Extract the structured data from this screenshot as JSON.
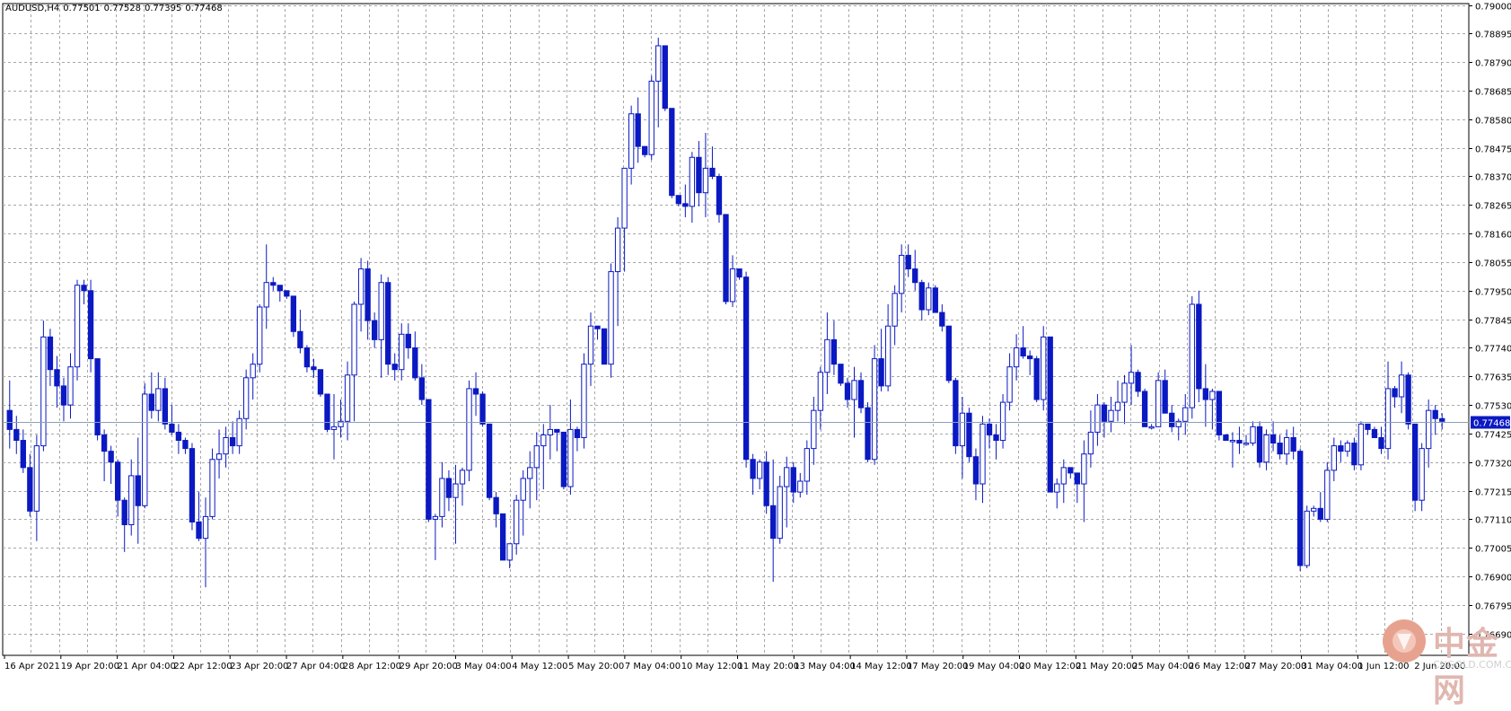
{
  "header": {
    "symbol": "AUDUSD,H4",
    "open": "0.77501",
    "high": "0.77528",
    "low": "0.77395",
    "close": "0.77468"
  },
  "price_tag": "0.77468",
  "logo": {
    "cn": "中金网",
    "en": "CNGOLD.COM.CN"
  },
  "colors": {
    "candle": "#0b19c2",
    "grid": "#a7a7a7",
    "axis_text": "#000000",
    "price_line": "#8aa0b8",
    "tag_bg": "#0b19c2",
    "tag_text": "#ffffff"
  },
  "chart_data": {
    "type": "candlestick",
    "ylim": [
      0.7661,
      0.79005
    ],
    "y_ticks": [
      "0.79000",
      "0.78895",
      "0.78790",
      "0.78685",
      "0.78580",
      "0.78475",
      "0.78370",
      "0.78265",
      "0.78160",
      "0.78055",
      "0.77950",
      "0.77845",
      "0.77740",
      "0.77635",
      "0.77530",
      "0.77425",
      "0.77320",
      "0.77215",
      "0.77110",
      "0.77005",
      "0.76900",
      "0.76795",
      "0.76690"
    ],
    "x_ticks": [
      "16 Apr 2021",
      "19 Apr 20:00",
      "21 Apr 04:00",
      "22 Apr 12:00",
      "23 Apr 20:00",
      "27 Apr 04:00",
      "28 Apr 12:00",
      "29 Apr 20:00",
      "3 May 04:00",
      "4 May 12:00",
      "5 May 20:00",
      "7 May 04:00",
      "10 May 12:00",
      "11 May 20:00",
      "13 May 04:00",
      "14 May 12:00",
      "17 May 20:00",
      "19 May 04:00",
      "20 May 12:00",
      "21 May 20:00",
      "25 May 04:00",
      "26 May 12:00",
      "27 May 20:00",
      "31 May 04:00",
      "1 Jun 12:00",
      "2 Jun 20:00"
    ],
    "last_price": 0.77468,
    "candles": [
      [
        0.7751,
        0.7762,
        0.7737,
        0.7744
      ],
      [
        0.7744,
        0.7749,
        0.7735,
        0.774
      ],
      [
        0.774,
        0.7744,
        0.7728,
        0.773
      ],
      [
        0.773,
        0.7735,
        0.7712,
        0.7714
      ],
      [
        0.7714,
        0.7742,
        0.7703,
        0.7738
      ],
      [
        0.7738,
        0.7784,
        0.7736,
        0.7778
      ],
      [
        0.7778,
        0.7781,
        0.776,
        0.7766
      ],
      [
        0.7766,
        0.7771,
        0.7752,
        0.776
      ],
      [
        0.776,
        0.7763,
        0.7747,
        0.7753
      ],
      [
        0.7753,
        0.7772,
        0.7748,
        0.7767
      ],
      [
        0.7767,
        0.7799,
        0.7762,
        0.7797
      ],
      [
        0.7797,
        0.7799,
        0.779,
        0.7795
      ],
      [
        0.7795,
        0.7799,
        0.7765,
        0.777
      ],
      [
        0.777,
        0.777,
        0.774,
        0.7742
      ],
      [
        0.7742,
        0.7744,
        0.7725,
        0.7736
      ],
      [
        0.7736,
        0.7738,
        0.7724,
        0.7732
      ],
      [
        0.7732,
        0.7733,
        0.7712,
        0.7718
      ],
      [
        0.7718,
        0.7719,
        0.7699,
        0.7709
      ],
      [
        0.7709,
        0.7733,
        0.7705,
        0.7727
      ],
      [
        0.7727,
        0.7741,
        0.7702,
        0.7716
      ],
      [
        0.7716,
        0.7761,
        0.7715,
        0.7757
      ],
      [
        0.7757,
        0.7765,
        0.7748,
        0.7751
      ],
      [
        0.7751,
        0.7765,
        0.7747,
        0.7759
      ],
      [
        0.7759,
        0.7763,
        0.7744,
        0.7746
      ],
      [
        0.7746,
        0.7753,
        0.7742,
        0.7743
      ],
      [
        0.7743,
        0.7746,
        0.7735,
        0.774
      ],
      [
        0.774,
        0.7741,
        0.7735,
        0.7737
      ],
      [
        0.7737,
        0.7739,
        0.7707,
        0.771
      ],
      [
        0.771,
        0.7721,
        0.7703,
        0.7704
      ],
      [
        0.7704,
        0.7719,
        0.7686,
        0.7712
      ],
      [
        0.7712,
        0.7737,
        0.7711,
        0.7733
      ],
      [
        0.7733,
        0.7744,
        0.7726,
        0.7735
      ],
      [
        0.7735,
        0.7745,
        0.773,
        0.7741
      ],
      [
        0.7741,
        0.7747,
        0.7735,
        0.7738
      ],
      [
        0.7738,
        0.7751,
        0.7735,
        0.7748
      ],
      [
        0.7748,
        0.7766,
        0.7744,
        0.7763
      ],
      [
        0.7763,
        0.7772,
        0.7755,
        0.7768
      ],
      [
        0.7768,
        0.779,
        0.7765,
        0.7789
      ],
      [
        0.7789,
        0.7812,
        0.7781,
        0.7798
      ],
      [
        0.7798,
        0.78,
        0.7795,
        0.7797
      ],
      [
        0.7797,
        0.7797,
        0.7791,
        0.7795
      ],
      [
        0.7795,
        0.7795,
        0.7792,
        0.7793
      ],
      [
        0.7793,
        0.7792,
        0.7778,
        0.778
      ],
      [
        0.778,
        0.7788,
        0.7772,
        0.7774
      ],
      [
        0.7774,
        0.7775,
        0.7765,
        0.7767
      ],
      [
        0.7767,
        0.777,
        0.7763,
        0.7766
      ],
      [
        0.7766,
        0.7766,
        0.7756,
        0.7757
      ],
      [
        0.7757,
        0.7757,
        0.7743,
        0.7744
      ],
      [
        0.7744,
        0.7757,
        0.7733,
        0.7745
      ],
      [
        0.7745,
        0.7755,
        0.7741,
        0.7747
      ],
      [
        0.7747,
        0.7769,
        0.774,
        0.7764
      ],
      [
        0.7764,
        0.7791,
        0.7747,
        0.779
      ],
      [
        0.779,
        0.7807,
        0.778,
        0.7803
      ],
      [
        0.7803,
        0.7806,
        0.7777,
        0.7784
      ],
      [
        0.7784,
        0.7787,
        0.7774,
        0.7777
      ],
      [
        0.7777,
        0.7801,
        0.7763,
        0.7798
      ],
      [
        0.7798,
        0.78,
        0.7764,
        0.7768
      ],
      [
        0.7768,
        0.7772,
        0.7762,
        0.7766
      ],
      [
        0.7766,
        0.7783,
        0.7762,
        0.7779
      ],
      [
        0.7779,
        0.7783,
        0.777,
        0.7774
      ],
      [
        0.7774,
        0.778,
        0.7762,
        0.7763
      ],
      [
        0.7763,
        0.7768,
        0.7753,
        0.7755
      ],
      [
        0.7755,
        0.7754,
        0.771,
        0.7711
      ],
      [
        0.7711,
        0.7713,
        0.7696,
        0.7712
      ],
      [
        0.7712,
        0.7732,
        0.7708,
        0.7726
      ],
      [
        0.7726,
        0.7729,
        0.7714,
        0.7719
      ],
      [
        0.7719,
        0.7731,
        0.7702,
        0.7724
      ],
      [
        0.7724,
        0.773,
        0.7716,
        0.7729
      ],
      [
        0.7729,
        0.7762,
        0.7725,
        0.7759
      ],
      [
        0.7759,
        0.7765,
        0.7749,
        0.7757
      ],
      [
        0.7757,
        0.7758,
        0.7745,
        0.7746
      ],
      [
        0.7746,
        0.7746,
        0.7718,
        0.7719
      ],
      [
        0.7719,
        0.7721,
        0.7708,
        0.7713
      ],
      [
        0.7713,
        0.7713,
        0.7703,
        0.7696
      ],
      [
        0.7696,
        0.7696,
        0.7693,
        0.7702
      ],
      [
        0.7702,
        0.772,
        0.7698,
        0.7718
      ],
      [
        0.7718,
        0.7729,
        0.7705,
        0.7726
      ],
      [
        0.7726,
        0.7736,
        0.7715,
        0.773
      ],
      [
        0.773,
        0.7743,
        0.7718,
        0.7738
      ],
      [
        0.7738,
        0.7746,
        0.7722,
        0.7742
      ],
      [
        0.7742,
        0.7753,
        0.7733,
        0.7744
      ],
      [
        0.7744,
        0.7744,
        0.7736,
        0.7743
      ],
      [
        0.7743,
        0.7741,
        0.7722,
        0.7723
      ],
      [
        0.7723,
        0.7755,
        0.772,
        0.7744
      ],
      [
        0.7744,
        0.7745,
        0.7736,
        0.7741
      ],
      [
        0.7741,
        0.7772,
        0.7737,
        0.7768
      ],
      [
        0.7768,
        0.7787,
        0.776,
        0.7782
      ],
      [
        0.7782,
        0.7782,
        0.7777,
        0.7781
      ],
      [
        0.7781,
        0.778,
        0.7769,
        0.7768
      ],
      [
        0.7768,
        0.7805,
        0.7763,
        0.7802
      ],
      [
        0.7802,
        0.7822,
        0.7782,
        0.7818
      ],
      [
        0.7818,
        0.783,
        0.7802,
        0.784
      ],
      [
        0.784,
        0.7863,
        0.7834,
        0.786
      ],
      [
        0.786,
        0.7866,
        0.7842,
        0.7848
      ],
      [
        0.7848,
        0.7847,
        0.7844,
        0.7845
      ],
      [
        0.7845,
        0.7874,
        0.7843,
        0.7872
      ],
      [
        0.7872,
        0.7888,
        0.7855,
        0.7885
      ],
      [
        0.7885,
        0.7884,
        0.7861,
        0.7862
      ],
      [
        0.7862,
        0.7862,
        0.7829,
        0.783
      ],
      [
        0.783,
        0.7829,
        0.7826,
        0.7827
      ],
      [
        0.7827,
        0.7834,
        0.7822,
        0.7826
      ],
      [
        0.7826,
        0.7846,
        0.782,
        0.7844
      ],
      [
        0.7844,
        0.785,
        0.7826,
        0.7831
      ],
      [
        0.7831,
        0.7853,
        0.7822,
        0.784
      ],
      [
        0.784,
        0.7848,
        0.7836,
        0.7837
      ],
      [
        0.7837,
        0.7838,
        0.782,
        0.7823
      ],
      [
        0.7823,
        0.7822,
        0.779,
        0.7791
      ],
      [
        0.7791,
        0.7808,
        0.7789,
        0.7803
      ],
      [
        0.7803,
        0.7803,
        0.7799,
        0.78
      ],
      [
        0.78,
        0.7802,
        0.773,
        0.7733
      ],
      [
        0.7733,
        0.7735,
        0.772,
        0.7726
      ],
      [
        0.7726,
        0.7733,
        0.7722,
        0.7732
      ],
      [
        0.7732,
        0.7736,
        0.7713,
        0.7716
      ],
      [
        0.7716,
        0.7733,
        0.7688,
        0.7704
      ],
      [
        0.7704,
        0.7727,
        0.7702,
        0.7723
      ],
      [
        0.7723,
        0.7734,
        0.7708,
        0.773
      ],
      [
        0.773,
        0.7732,
        0.7717,
        0.7721
      ],
      [
        0.7721,
        0.7728,
        0.7719,
        0.7725
      ],
      [
        0.7725,
        0.774,
        0.772,
        0.7737
      ],
      [
        0.7737,
        0.7756,
        0.7731,
        0.7751
      ],
      [
        0.7751,
        0.7767,
        0.7744,
        0.7765
      ],
      [
        0.7765,
        0.7787,
        0.7757,
        0.7777
      ],
      [
        0.7777,
        0.7784,
        0.7764,
        0.7768
      ],
      [
        0.7768,
        0.7767,
        0.776,
        0.7761
      ],
      [
        0.7761,
        0.7763,
        0.7752,
        0.7755
      ],
      [
        0.7755,
        0.7767,
        0.7741,
        0.7762
      ],
      [
        0.7762,
        0.7765,
        0.775,
        0.7752
      ],
      [
        0.7752,
        0.7754,
        0.7732,
        0.7733
      ],
      [
        0.7733,
        0.7775,
        0.7731,
        0.777
      ],
      [
        0.777,
        0.7781,
        0.7758,
        0.776
      ],
      [
        0.776,
        0.779,
        0.7758,
        0.7782
      ],
      [
        0.7782,
        0.7797,
        0.7775,
        0.7794
      ],
      [
        0.7794,
        0.7812,
        0.7787,
        0.7808
      ],
      [
        0.7808,
        0.7812,
        0.78,
        0.7803
      ],
      [
        0.7803,
        0.781,
        0.7795,
        0.7798
      ],
      [
        0.7798,
        0.7799,
        0.7784,
        0.7788
      ],
      [
        0.7788,
        0.7798,
        0.7786,
        0.7796
      ],
      [
        0.7796,
        0.7797,
        0.7788,
        0.7787
      ],
      [
        0.7787,
        0.779,
        0.778,
        0.7782
      ],
      [
        0.7782,
        0.7782,
        0.7761,
        0.7762
      ],
      [
        0.7762,
        0.7763,
        0.7735,
        0.7738
      ],
      [
        0.7738,
        0.7756,
        0.7726,
        0.775
      ],
      [
        0.775,
        0.7752,
        0.7732,
        0.7734
      ],
      [
        0.7734,
        0.7737,
        0.7718,
        0.7724
      ],
      [
        0.7724,
        0.7749,
        0.7717,
        0.7746
      ],
      [
        0.7746,
        0.7748,
        0.7737,
        0.7742
      ],
      [
        0.7742,
        0.7746,
        0.7733,
        0.774
      ],
      [
        0.774,
        0.7757,
        0.7737,
        0.7754
      ],
      [
        0.7754,
        0.7772,
        0.7751,
        0.7767
      ],
      [
        0.7767,
        0.7779,
        0.7762,
        0.7774
      ],
      [
        0.7774,
        0.7782,
        0.777,
        0.7771
      ],
      [
        0.7771,
        0.7773,
        0.7764,
        0.777
      ],
      [
        0.777,
        0.7771,
        0.7754,
        0.7755
      ],
      [
        0.7755,
        0.7782,
        0.7751,
        0.7778
      ],
      [
        0.7778,
        0.7777,
        0.7741,
        0.7721
      ],
      [
        0.7721,
        0.7726,
        0.7715,
        0.7724
      ],
      [
        0.7724,
        0.7733,
        0.7717,
        0.773
      ],
      [
        0.773,
        0.7729,
        0.7726,
        0.7728
      ],
      [
        0.7728,
        0.7728,
        0.7717,
        0.7724
      ],
      [
        0.7724,
        0.774,
        0.771,
        0.7735
      ],
      [
        0.7735,
        0.7751,
        0.773,
        0.7743
      ],
      [
        0.7743,
        0.7757,
        0.7738,
        0.7753
      ],
      [
        0.7753,
        0.7754,
        0.7741,
        0.7747
      ],
      [
        0.7747,
        0.7756,
        0.7743,
        0.7751
      ],
      [
        0.7751,
        0.7762,
        0.7747,
        0.7754
      ],
      [
        0.7754,
        0.7764,
        0.7746,
        0.7761
      ],
      [
        0.7761,
        0.7775,
        0.7753,
        0.7765
      ],
      [
        0.7765,
        0.7766,
        0.7756,
        0.7758
      ],
      [
        0.7758,
        0.7759,
        0.7749,
        0.7745
      ],
      [
        0.7745,
        0.7746,
        0.7744,
        0.7745
      ],
      [
        0.7745,
        0.7765,
        0.7745,
        0.7762
      ],
      [
        0.7762,
        0.7766,
        0.7752,
        0.775
      ],
      [
        0.775,
        0.7753,
        0.7743,
        0.7745
      ],
      [
        0.7745,
        0.7748,
        0.774,
        0.7747
      ],
      [
        0.7747,
        0.7757,
        0.7742,
        0.7752
      ],
      [
        0.7752,
        0.7793,
        0.7748,
        0.779
      ],
      [
        0.779,
        0.7795,
        0.7754,
        0.7759
      ],
      [
        0.7759,
        0.7768,
        0.7745,
        0.7755
      ],
      [
        0.7755,
        0.7759,
        0.7744,
        0.7758
      ],
      [
        0.7758,
        0.7758,
        0.774,
        0.7742
      ],
      [
        0.7742,
        0.7741,
        0.774,
        0.774
      ],
      [
        0.774,
        0.7743,
        0.773,
        0.774
      ],
      [
        0.774,
        0.7745,
        0.7735,
        0.7739
      ],
      [
        0.7739,
        0.7742,
        0.7738,
        0.7739
      ],
      [
        0.7739,
        0.7747,
        0.7738,
        0.7745
      ],
      [
        0.7745,
        0.7747,
        0.773,
        0.7732
      ],
      [
        0.7732,
        0.7744,
        0.7729,
        0.7742
      ],
      [
        0.7742,
        0.7747,
        0.7736,
        0.7739
      ],
      [
        0.7739,
        0.7742,
        0.7733,
        0.7735
      ],
      [
        0.7735,
        0.7744,
        0.7731,
        0.7741
      ],
      [
        0.7741,
        0.7745,
        0.7733,
        0.7736
      ],
      [
        0.7736,
        0.7737,
        0.7692,
        0.7694
      ],
      [
        0.7694,
        0.7716,
        0.7693,
        0.7714
      ],
      [
        0.7714,
        0.7716,
        0.7712,
        0.7715
      ],
      [
        0.7715,
        0.7721,
        0.771,
        0.7711
      ],
      [
        0.7711,
        0.7732,
        0.771,
        0.7729
      ],
      [
        0.7729,
        0.7741,
        0.7725,
        0.7738
      ],
      [
        0.7738,
        0.774,
        0.7732,
        0.7736
      ],
      [
        0.7736,
        0.774,
        0.7734,
        0.7739
      ],
      [
        0.7739,
        0.7741,
        0.7729,
        0.7731
      ],
      [
        0.7731,
        0.7747,
        0.7729,
        0.7746
      ],
      [
        0.7746,
        0.7746,
        0.7742,
        0.7744
      ],
      [
        0.7744,
        0.7745,
        0.7742,
        0.7741
      ],
      [
        0.7741,
        0.7745,
        0.7735,
        0.7737
      ],
      [
        0.7737,
        0.7769,
        0.7733,
        0.7759
      ],
      [
        0.7759,
        0.776,
        0.7752,
        0.7756
      ],
      [
        0.7756,
        0.7769,
        0.775,
        0.7764
      ],
      [
        0.7764,
        0.7765,
        0.7744,
        0.7746
      ],
      [
        0.7746,
        0.7746,
        0.7714,
        0.7718
      ],
      [
        0.7718,
        0.7739,
        0.7714,
        0.7737
      ],
      [
        0.7737,
        0.7755,
        0.773,
        0.7751
      ],
      [
        0.7751,
        0.7753,
        0.7742,
        0.7748
      ],
      [
        0.7748,
        0.775,
        0.7744,
        0.7747
      ]
    ]
  }
}
